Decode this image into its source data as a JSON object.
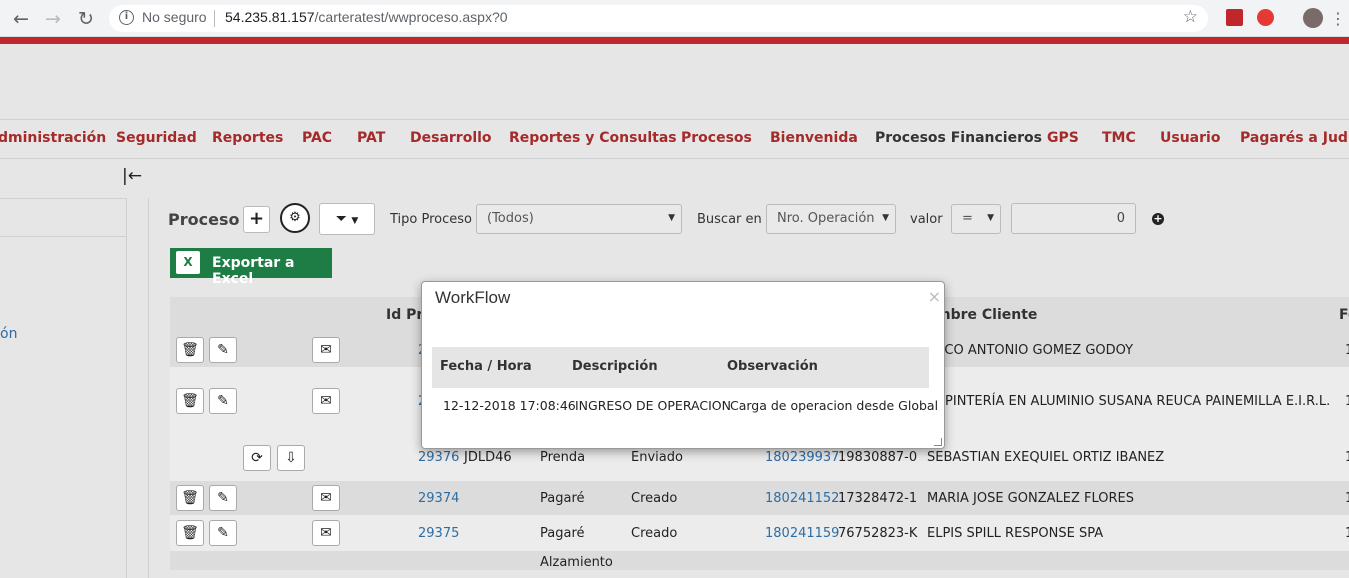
{
  "browser": {
    "security_label": "No seguro",
    "url_host": "54.235.81.157",
    "url_path": "/carteratest/wwproceso.aspx?0"
  },
  "menu": {
    "items": [
      "dministración",
      "Seguridad",
      "Reportes",
      "PAC",
      "PAT",
      "Desarrollo",
      "Reportes y Consultas",
      "Procesos",
      "Bienvenida",
      "Procesos Financieros",
      "GPS",
      "TMC",
      "Usuario",
      "Pagarés a Judici"
    ],
    "accent_color": "#a52a2a"
  },
  "sidebar": {
    "link_fragment": "ón"
  },
  "toolbar": {
    "title": "Proceso",
    "tipo_label": "Tipo Proceso",
    "tipo_value": "(Todos)",
    "buscar_label": "Buscar en",
    "buscar_value": "Nro. Operación",
    "valor_label": "valor",
    "operator_value": "=",
    "search_value": "0",
    "excel_label": "Exportar a Excel"
  },
  "grid": {
    "headers": {
      "id": "Id Pro",
      "client": "mbre Cliente",
      "last": "Fe"
    },
    "rows": [
      {
        "id": "2",
        "code": "",
        "type": "",
        "state": "",
        "op": "",
        "rut": "",
        "client": "RCO ANTONIO GOMEZ GODOY",
        "last": "1"
      },
      {
        "id": "2",
        "code": "",
        "type": "",
        "state": "",
        "op": "",
        "rut": "",
        "client": "RPINTERÍA EN ALUMINIO SUSANA REUCA PAINEMILLA E.I.R.L.",
        "last": "1"
      },
      {
        "id": "29376",
        "code": "JDLD46",
        "type": "Prenda",
        "state": "Enviado",
        "op": "180239937",
        "rut": "19830887-0",
        "client": "SEBASTIAN EXEQUIEL ORTIZ IBANEZ",
        "last": "1"
      },
      {
        "id": "29374",
        "code": "",
        "type": "Pagaré",
        "state": "Creado",
        "op": "180241152",
        "rut": "17328472-1",
        "client": "MARIA JOSE GONZALEZ FLORES",
        "last": "1"
      },
      {
        "id": "29375",
        "code": "",
        "type": "Pagaré",
        "state": "Creado",
        "op": "180241159",
        "rut": "76752823-K",
        "client": "ELPIS SPILL RESPONSE SPA",
        "last": "1"
      },
      {
        "id": "",
        "code": "",
        "type": "Alzamiento",
        "state": "",
        "op": "",
        "rut": "",
        "client": "",
        "last": ""
      }
    ]
  },
  "modal": {
    "title": "WorkFlow",
    "close": "×",
    "headers": [
      "Fecha / Hora",
      "Descripción",
      "Observación"
    ],
    "row": [
      "12-12-2018 17:08:46",
      "INGRESO DE OPERACION",
      "Carga de operacion desde Global"
    ]
  }
}
